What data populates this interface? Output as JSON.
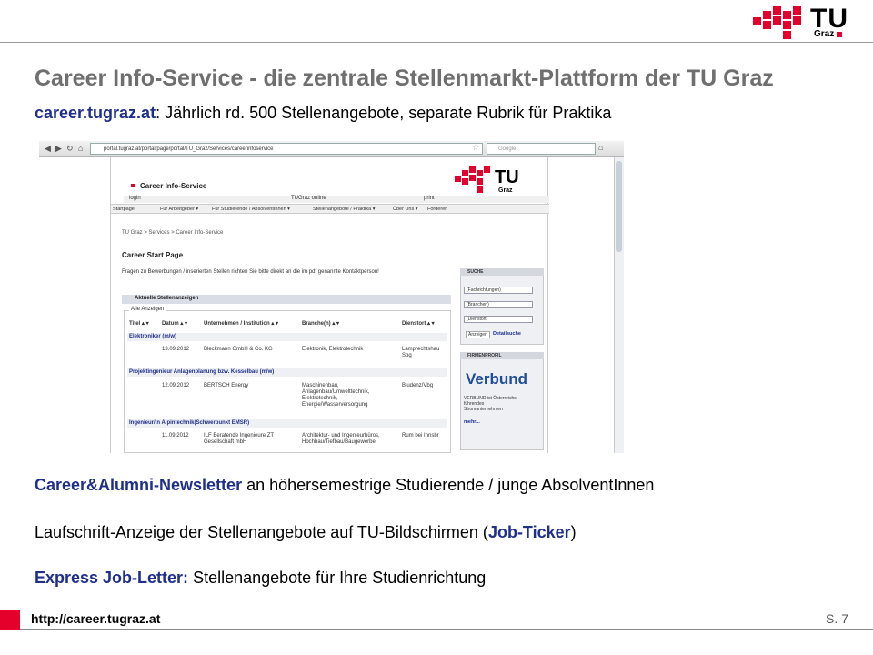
{
  "header": {
    "logo_tu": "TU",
    "logo_graz": "Graz",
    "brand_color": "#e4002b"
  },
  "slide": {
    "title": "Career Info-Service - die zentrale Stellenmarkt-Plattform der TU Graz",
    "subtitle_link": "career.tugraz.at",
    "subtitle_rest": ": Jährlich rd. 500 Stellenangebote, separate Rubrik für Praktika",
    "bullets": [
      {
        "bold": "Career&Alumni-Newsletter",
        "rest": " an höhersemestrige Studierende / junge AbsolventInnen"
      },
      {
        "pre": "Laufschrift-Anzeige der Stellenangebote auf TU-Bildschirmen (",
        "bold": "Job-Ticker",
        "post": ")"
      },
      {
        "bold": "Express Job-Letter:",
        "rest": " Stellenangebote für Ihre Studienrichtung"
      }
    ]
  },
  "footer": {
    "url": "http://career.tugraz.at",
    "page": "S. 7"
  },
  "browser": {
    "url": "portal.tugraz.at/portal/page/portal/TU_Graz/Services/careerinfoservice",
    "search_placeholder": "Google",
    "site_title": "Career Info-Service",
    "toplinks": {
      "login": "login",
      "tugraz_online": "TUGraz online",
      "print": "print"
    },
    "menu": [
      "Startpage",
      "Für Arbeitgeber ▾",
      "Für Studierende / AbsolventInnen ▾",
      "Stellenangebote / Praktika ▾",
      "Über Uns ▾",
      "Förderer"
    ],
    "breadcrumb": "TU Graz > Services > Career Info-Service",
    "heading": "Career Start Page",
    "intro": "Fragen zu Bewerbungen / inserierten Stellen richten Sie bitte direkt an die im pdf genannte Kontaktperson!",
    "section_title": "Aktuelle Stellenanzeigen",
    "fieldset_label": "Alle Anzeigen",
    "columns": [
      "Titel ▴ ▾",
      "Datum ▴ ▾",
      "Unternehmen / Institution ▴ ▾",
      "Branche(n) ▴ ▾",
      "Dienstort ▴ ▾"
    ],
    "jobs": [
      {
        "title": "Elektroniker (m/w)",
        "date": "13.09.2012",
        "company": "Bleckmann GmbH & Co. KG",
        "branch": "Elektronik, Elektrotechnik",
        "place": "Lamprechtshau Sbg"
      },
      {
        "title": "Projektingenieur Anlagenplanung bzw. Kesselbau (m/w)",
        "date": "12.09.2012",
        "company": "BERTSCH Energy",
        "branch": "Maschinenbau, Anlagenbau/Umwelttechnik, Elektrotechnik, Energie/Wasserversorgung",
        "place": "Bludenz/Vbg"
      },
      {
        "title": "Ingenieur/in Alpintechnik(Schwerpunkt EMSR)",
        "date": "11.09.2012",
        "company": "ILF Beratende Ingenieure ZT Gesellschaft mbH",
        "branch": "Architektur- und Ingenieurbüros, Hochbau/Tiefbau/Baugewerbe",
        "place": "Rum bei Innsbr"
      }
    ],
    "sidebar": {
      "search_head": "SUCHE",
      "selects": [
        "(Fachrichtungen)",
        "(Branchen)",
        "(Dienstort)"
      ],
      "btn_search": "Anzeigen",
      "link_detail": "Detailsuche",
      "profile_head": "FIRMENPROFIL",
      "profile_logo": "Verbund",
      "profile_text": [
        "VERBUND ist Österreichs",
        "führendes",
        "Stromunternehmen"
      ],
      "more": "mehr..."
    }
  }
}
